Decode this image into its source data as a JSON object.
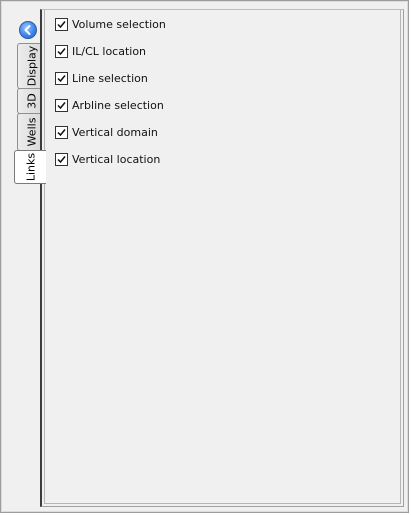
{
  "tabs": [
    {
      "label": "Display",
      "active": false
    },
    {
      "label": "3D",
      "active": false
    },
    {
      "label": "Wells",
      "active": false
    },
    {
      "label": "Links",
      "active": true
    }
  ],
  "back_icon": "back-arrow-icon",
  "links": {
    "options": [
      {
        "label": "Volume selection",
        "checked": true
      },
      {
        "label": "IL/CL location",
        "checked": true
      },
      {
        "label": "Line selection",
        "checked": true
      },
      {
        "label": "Arbline selection",
        "checked": true
      },
      {
        "label": "Vertical domain",
        "checked": true
      },
      {
        "label": "Vertical location",
        "checked": true
      }
    ]
  },
  "colors": {
    "back_button": "#3f86e8",
    "panel_background": "#f0f0f0",
    "active_tab": "#ffffff"
  }
}
